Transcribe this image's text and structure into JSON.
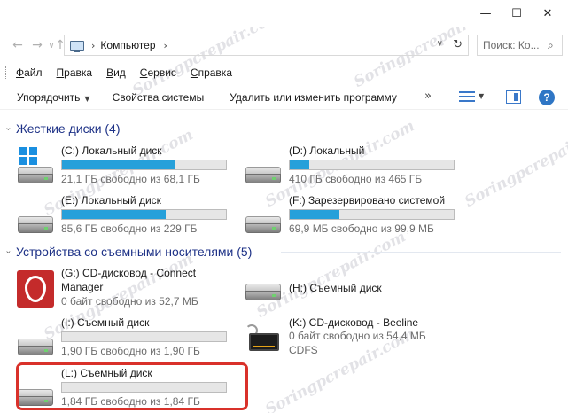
{
  "window": {
    "minimize_glyph": "—",
    "maximize_glyph": "☐",
    "close_glyph": "✕"
  },
  "address": {
    "back_glyph": "←",
    "forward_glyph": "→",
    "dropdown_glyph": "∨",
    "up_glyph": "↑",
    "path": "Компьютер",
    "search_placeholder": "Поиск: Ко..."
  },
  "menu": [
    "Файл",
    "Правка",
    "Вид",
    "Сервис",
    "Справка"
  ],
  "commands": {
    "organize": "Упорядочить",
    "system_properties": "Свойства системы",
    "uninstall": "Удалить или изменить программу",
    "more": "»",
    "help": "?"
  },
  "groups": {
    "hard_drives": {
      "label": "Жесткие диски (4)"
    },
    "removable": {
      "label": "Устройства со съемными носителями (5)"
    }
  },
  "hard_drives": [
    {
      "name": "(C:) Локальный диск",
      "free": "21,1 ГБ свободно из 68,1 ГБ",
      "fill_fraction": 0.69,
      "icon": "windows-drive-icon"
    },
    {
      "name": "(D:) Локальный",
      "free": "410 ГБ свободно из 465 ГБ",
      "fill_fraction": 0.12,
      "icon": "hard-drive-icon"
    },
    {
      "name": "(E:) Локальный диск",
      "free": "85,6 ГБ свободно из 229 ГБ",
      "fill_fraction": 0.63,
      "icon": "hard-drive-icon"
    },
    {
      "name": "(F:) Зарезервировано системой",
      "free": "69,9 МБ свободно из 99,9 МБ",
      "fill_fraction": 0.3,
      "icon": "hard-drive-icon"
    }
  ],
  "removable": [
    {
      "name_line1": "(G:) CD-дисковод - Connect",
      "name_line2": "Manager",
      "free": "0 байт свободно из 52,7 МБ",
      "icon": "cd-connect-manager-icon"
    },
    {
      "name": "(H:) Съемный диск",
      "icon": "removable-drive-icon"
    },
    {
      "name": "(I:) Съемный диск",
      "free": "1,90 ГБ свободно из 1,90 ГБ",
      "fill_fraction": 0.0,
      "icon": "removable-drive-icon"
    },
    {
      "name": "(K:) CD-дисковод - Beeline",
      "free": "0 байт свободно из 54,4 МБ",
      "fs": "CDFS",
      "icon": "beeline-modem-icon"
    },
    {
      "name": "(L:) Съемный диск",
      "free": "1,84 ГБ свободно из 1,84 ГБ",
      "fill_fraction": 0.0,
      "icon": "removable-drive-icon"
    }
  ],
  "watermark": "Soringpcrepair.com",
  "colors": {
    "usage_bar": "#26a0da",
    "group_header_text": "#1e3287",
    "highlight_border": "#d9312a"
  }
}
